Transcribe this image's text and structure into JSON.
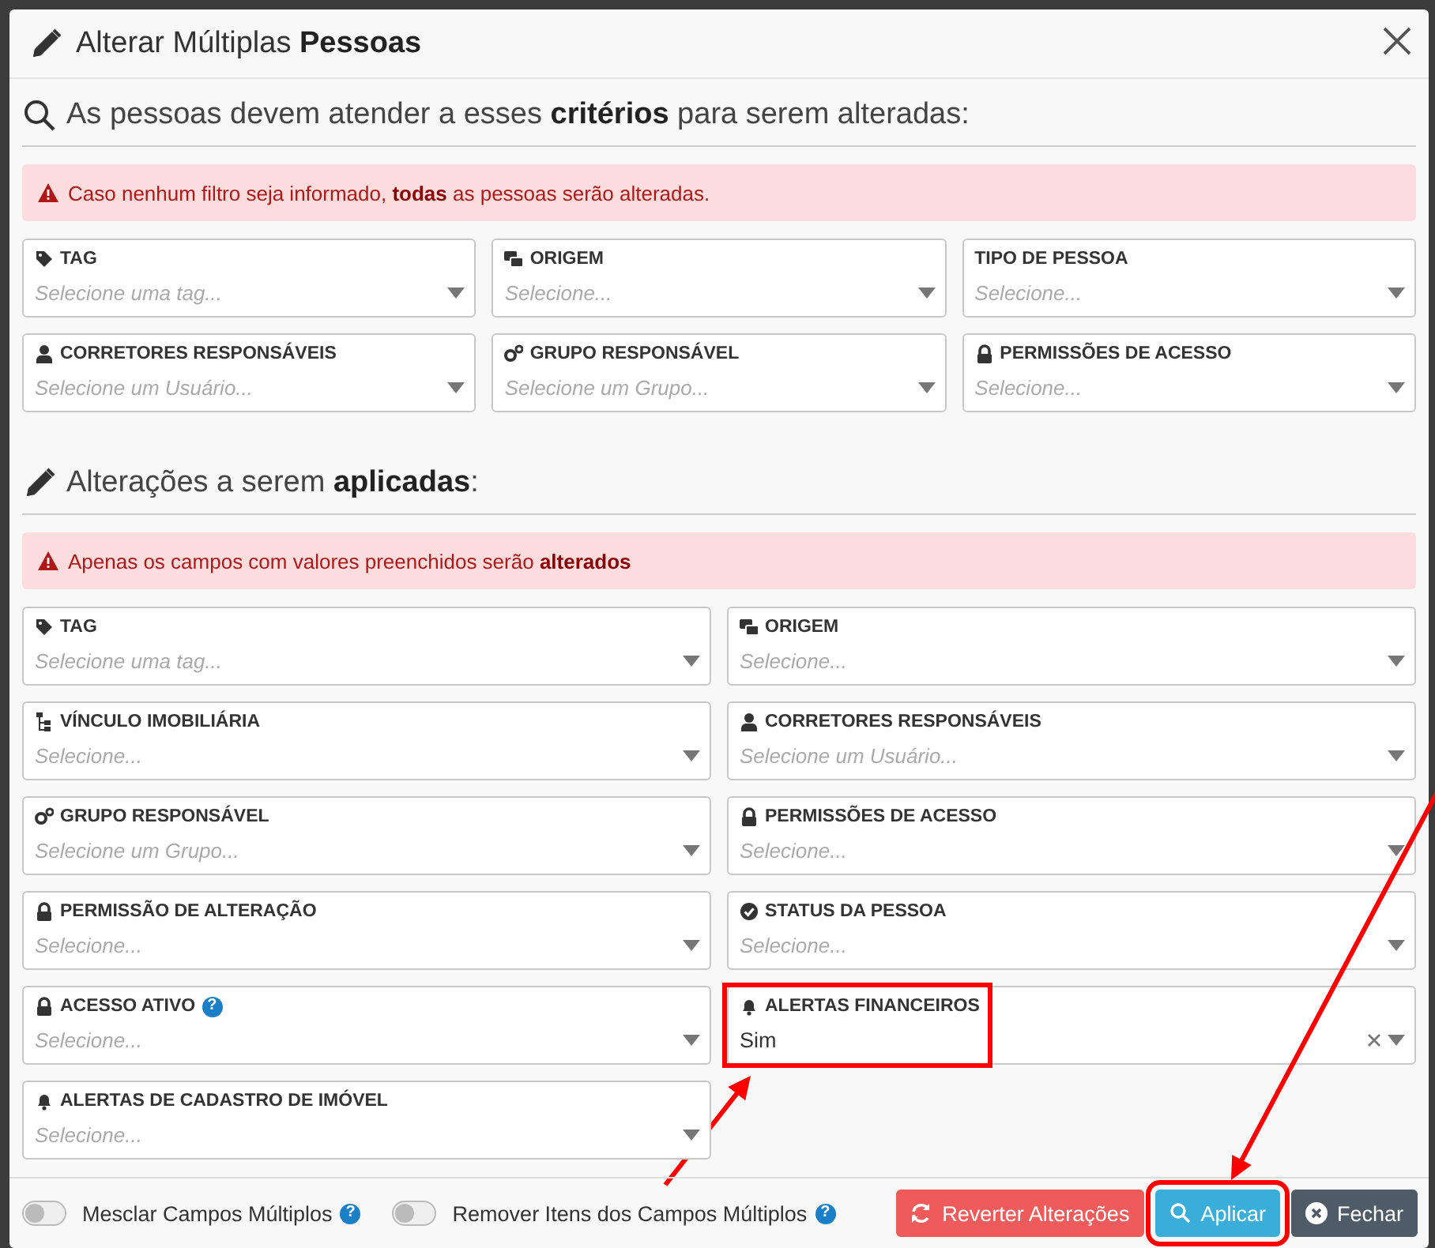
{
  "window": {
    "title_prefix": "Alterar Múltiplas",
    "title_bold": "Pessoas"
  },
  "criteria": {
    "heading": "As pessoas devem atender a esses **critérios** para serem alteradas:",
    "alert": "Caso nenhum filtro seja informado, **todas** as pessoas serão alteradas.",
    "fields": [
      {
        "kind": "tag",
        "label": "TAG",
        "placeholder": "Selecione uma tag..."
      },
      {
        "kind": "origin",
        "label": "ORIGEM",
        "placeholder": "Selecione..."
      },
      {
        "kind": "plain",
        "label": "TIPO DE PESSOA",
        "placeholder": "Selecione..."
      },
      {
        "kind": "user",
        "label": "CORRETORES RESPONSÁVEIS",
        "placeholder": "Selecione um Usuário..."
      },
      {
        "kind": "group",
        "label": "GRUPO RESPONSÁVEL",
        "placeholder": "Selecione um Grupo..."
      },
      {
        "kind": "lock",
        "label": "PERMISSÕES DE ACESSO",
        "placeholder": "Selecione..."
      }
    ]
  },
  "changes": {
    "heading": "Alterações a serem **aplicadas**:",
    "alert": "Apenas os campos com valores preenchidos serão **alterados**",
    "fields": [
      {
        "kind": "tag",
        "label": "TAG",
        "placeholder": "Selecione uma tag..."
      },
      {
        "kind": "origin",
        "label": "ORIGEM",
        "placeholder": "Selecione..."
      },
      {
        "kind": "link",
        "label": "VÍNCULO IMOBILIÁRIA",
        "placeholder": "Selecione..."
      },
      {
        "kind": "user",
        "label": "CORRETORES RESPONSÁVEIS",
        "placeholder": "Selecione um Usuário..."
      },
      {
        "kind": "group",
        "label": "GRUPO RESPONSÁVEL",
        "placeholder": "Selecione um Grupo..."
      },
      {
        "kind": "lock",
        "label": "PERMISSÕES DE ACESSO",
        "placeholder": "Selecione..."
      },
      {
        "kind": "lock",
        "label": "PERMISSÃO DE ALTERAÇÃO",
        "placeholder": "Selecione..."
      },
      {
        "kind": "status",
        "label": "STATUS DA PESSOA",
        "placeholder": "Selecione..."
      },
      {
        "kind": "lock",
        "label": "ACESSO ATIVO",
        "placeholder": "Selecione...",
        "help": "?"
      },
      {
        "kind": "alert",
        "label": "ALERTAS FINANCEIROS",
        "value": "Sim",
        "highlighted": true
      },
      {
        "kind": "alert",
        "label": "ALERTAS DE CADASTRO DE IMÓVEL",
        "placeholder": "Selecione..."
      }
    ]
  },
  "footer": {
    "toggles": [
      {
        "label": "Mesclar Campos Múltiplos",
        "on": false,
        "help": "?"
      },
      {
        "label": "Remover Itens dos Campos Múltiplos",
        "on": false,
        "help": "?"
      }
    ],
    "buttons": [
      {
        "kind": "revert",
        "label": "Reverter Alterações"
      },
      {
        "kind": "apply",
        "label": "Aplicar",
        "highlighted": true
      },
      {
        "kind": "close",
        "label": "Fechar"
      }
    ]
  }
}
